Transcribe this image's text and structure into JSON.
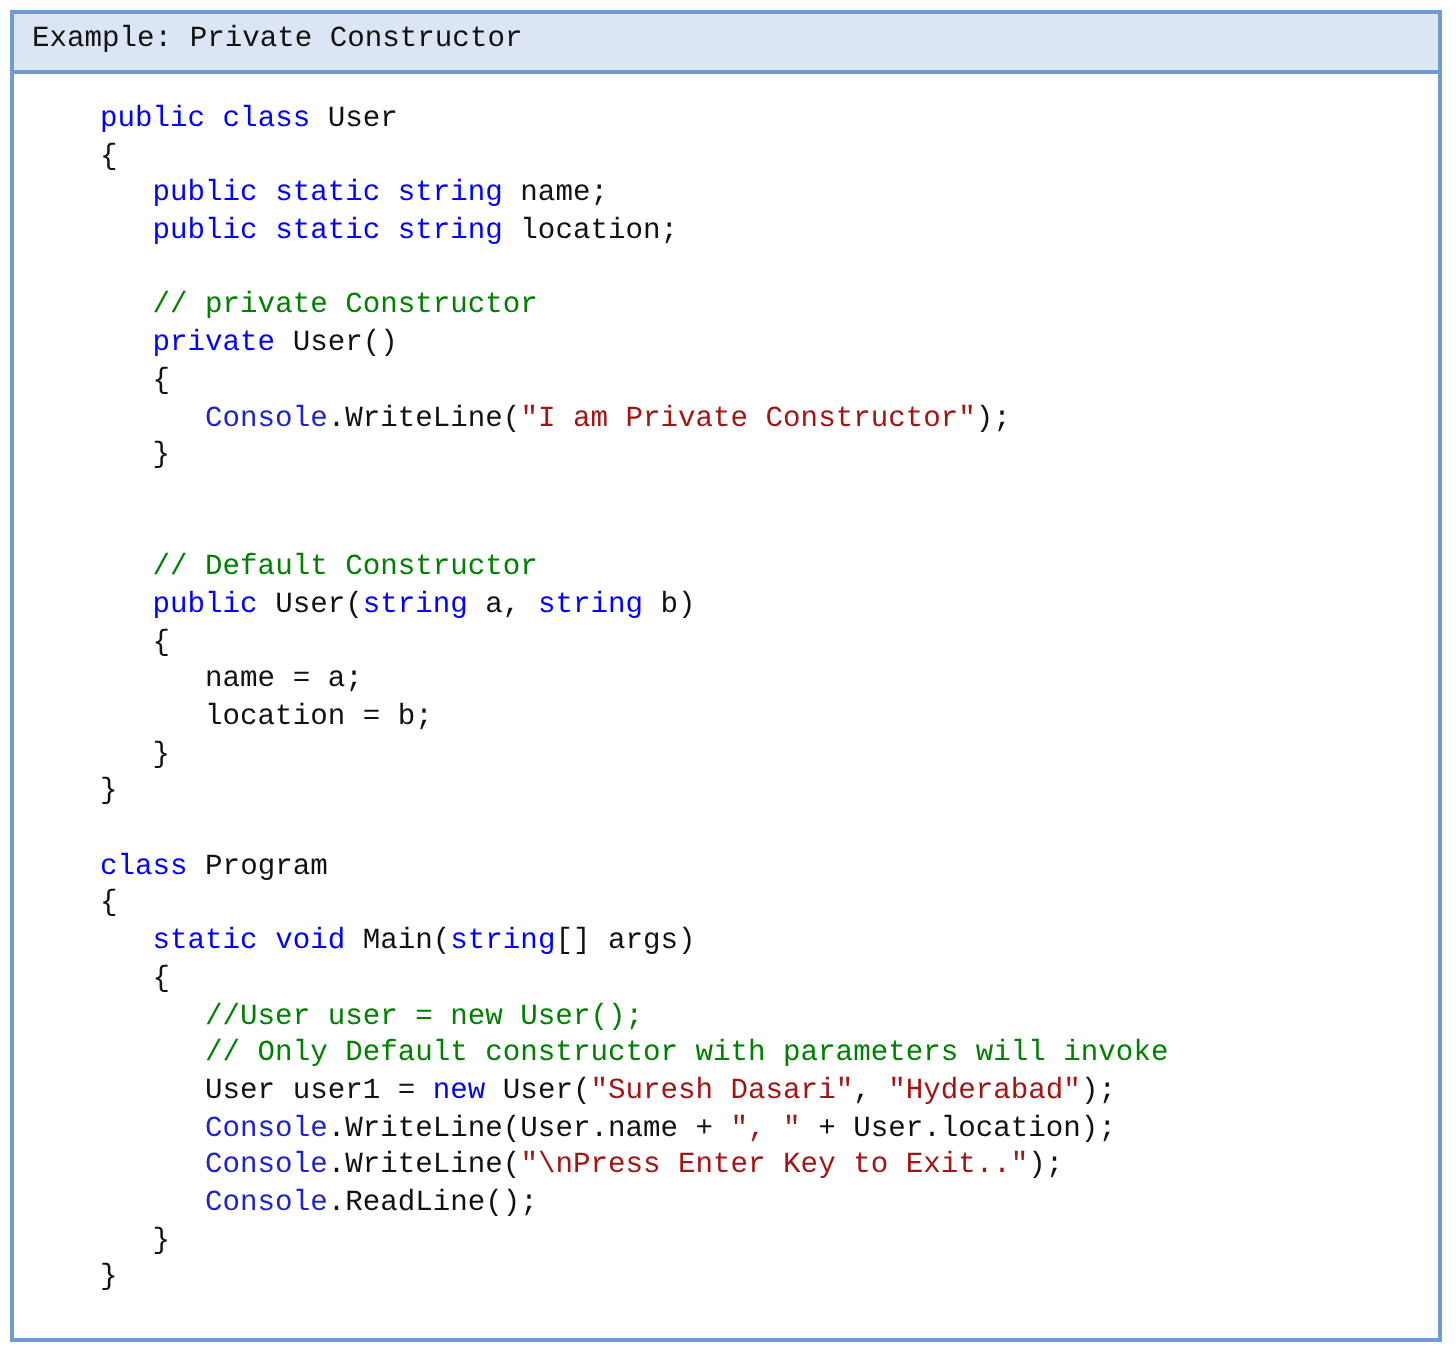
{
  "example": {
    "title": "Example: Private Constructor",
    "lines": [
      {
        "kind": "code",
        "tokens": [
          {
            "kind": "keyword",
            "text": "public class"
          },
          {
            "kind": "plain",
            "text": " User"
          }
        ]
      },
      {
        "kind": "code",
        "tokens": [
          {
            "kind": "plain",
            "text": "{"
          }
        ],
        "children": [
          {
            "kind": "code",
            "tokens": [
              {
                "kind": "keyword",
                "text": "public static string"
              },
              {
                "kind": "plain",
                "text": " name;"
              }
            ]
          },
          {
            "kind": "code",
            "tokens": [
              {
                "kind": "keyword",
                "text": "public static string"
              },
              {
                "kind": "plain",
                "text": " location;"
              }
            ]
          },
          {
            "kind": "blank"
          },
          {
            "kind": "code",
            "tokens": [
              {
                "kind": "comment",
                "text": "// private Constructor"
              }
            ]
          },
          {
            "kind": "code",
            "tokens": [
              {
                "kind": "keyword",
                "text": "private"
              },
              {
                "kind": "plain",
                "text": " User()"
              }
            ]
          },
          {
            "kind": "code",
            "tokens": [
              {
                "kind": "plain",
                "text": "{"
              }
            ],
            "children": [
              {
                "kind": "code",
                "tokens": [
                  {
                    "kind": "type",
                    "text": "Console"
                  },
                  {
                    "kind": "plain",
                    "text": ".WriteLine("
                  },
                  {
                    "kind": "string",
                    "text": "\"I am Private Constructor\""
                  },
                  {
                    "kind": "plain",
                    "text": ");"
                  }
                ]
              }
            ]
          },
          {
            "kind": "code",
            "tokens": [
              {
                "kind": "plain",
                "text": "}"
              }
            ]
          },
          {
            "kind": "blank"
          },
          {
            "kind": "blank"
          },
          {
            "kind": "code",
            "tokens": [
              {
                "kind": "comment",
                "text": "// Default Constructor"
              }
            ]
          },
          {
            "kind": "code",
            "tokens": [
              {
                "kind": "keyword",
                "text": "public"
              },
              {
                "kind": "plain",
                "text": " User("
              },
              {
                "kind": "keyword",
                "text": "string"
              },
              {
                "kind": "plain",
                "text": " a, "
              },
              {
                "kind": "keyword",
                "text": "string"
              },
              {
                "kind": "plain",
                "text": " b)"
              }
            ]
          },
          {
            "kind": "code",
            "tokens": [
              {
                "kind": "plain",
                "text": "{"
              }
            ],
            "children": [
              {
                "kind": "code",
                "tokens": [
                  {
                    "kind": "plain",
                    "text": "name = a;"
                  }
                ]
              },
              {
                "kind": "code",
                "tokens": [
                  {
                    "kind": "plain",
                    "text": "location = b;"
                  }
                ]
              }
            ]
          },
          {
            "kind": "code",
            "tokens": [
              {
                "kind": "plain",
                "text": "}"
              }
            ]
          }
        ]
      },
      {
        "kind": "code",
        "tokens": [
          {
            "kind": "plain",
            "text": "}"
          }
        ]
      },
      {
        "kind": "blank"
      },
      {
        "kind": "code",
        "tokens": [
          {
            "kind": "keyword",
            "text": "class"
          },
          {
            "kind": "plain",
            "text": " Program"
          }
        ]
      },
      {
        "kind": "code",
        "tokens": [
          {
            "kind": "plain",
            "text": "{"
          }
        ],
        "children": [
          {
            "kind": "code",
            "tokens": [
              {
                "kind": "keyword",
                "text": "static void"
              },
              {
                "kind": "plain",
                "text": " Main("
              },
              {
                "kind": "keyword",
                "text": "string"
              },
              {
                "kind": "plain",
                "text": "[] args)"
              }
            ]
          },
          {
            "kind": "code",
            "tokens": [
              {
                "kind": "plain",
                "text": "{"
              }
            ],
            "children": [
              {
                "kind": "code",
                "tokens": [
                  {
                    "kind": "comment",
                    "text": "//User user = new User();"
                  }
                ]
              },
              {
                "kind": "code",
                "tokens": [
                  {
                    "kind": "comment",
                    "text": "// Only Default constructor with parameters will invoke"
                  }
                ]
              },
              {
                "kind": "code",
                "tokens": [
                  {
                    "kind": "plain",
                    "text": "User user1 = "
                  },
                  {
                    "kind": "keyword",
                    "text": "new"
                  },
                  {
                    "kind": "plain",
                    "text": " User("
                  },
                  {
                    "kind": "string",
                    "text": "\"Suresh Dasari\""
                  },
                  {
                    "kind": "plain",
                    "text": ", "
                  },
                  {
                    "kind": "string",
                    "text": "\"Hyderabad\""
                  },
                  {
                    "kind": "plain",
                    "text": ");"
                  }
                ]
              },
              {
                "kind": "code",
                "tokens": [
                  {
                    "kind": "type",
                    "text": "Console"
                  },
                  {
                    "kind": "plain",
                    "text": ".WriteLine(User.name + "
                  },
                  {
                    "kind": "string",
                    "text": "\", \""
                  },
                  {
                    "kind": "plain",
                    "text": " + User.location);"
                  }
                ]
              },
              {
                "kind": "code",
                "tokens": [
                  {
                    "kind": "type",
                    "text": "Console"
                  },
                  {
                    "kind": "plain",
                    "text": ".WriteLine("
                  },
                  {
                    "kind": "string",
                    "text": "\"\\nPress Enter Key to Exit..\""
                  },
                  {
                    "kind": "plain",
                    "text": ");"
                  }
                ]
              },
              {
                "kind": "code",
                "tokens": [
                  {
                    "kind": "type",
                    "text": "Console"
                  },
                  {
                    "kind": "plain",
                    "text": ".ReadLine();"
                  }
                ]
              }
            ]
          },
          {
            "kind": "code",
            "tokens": [
              {
                "kind": "plain",
                "text": "}"
              }
            ]
          }
        ]
      },
      {
        "kind": "code",
        "tokens": [
          {
            "kind": "plain",
            "text": "}"
          }
        ]
      }
    ]
  }
}
